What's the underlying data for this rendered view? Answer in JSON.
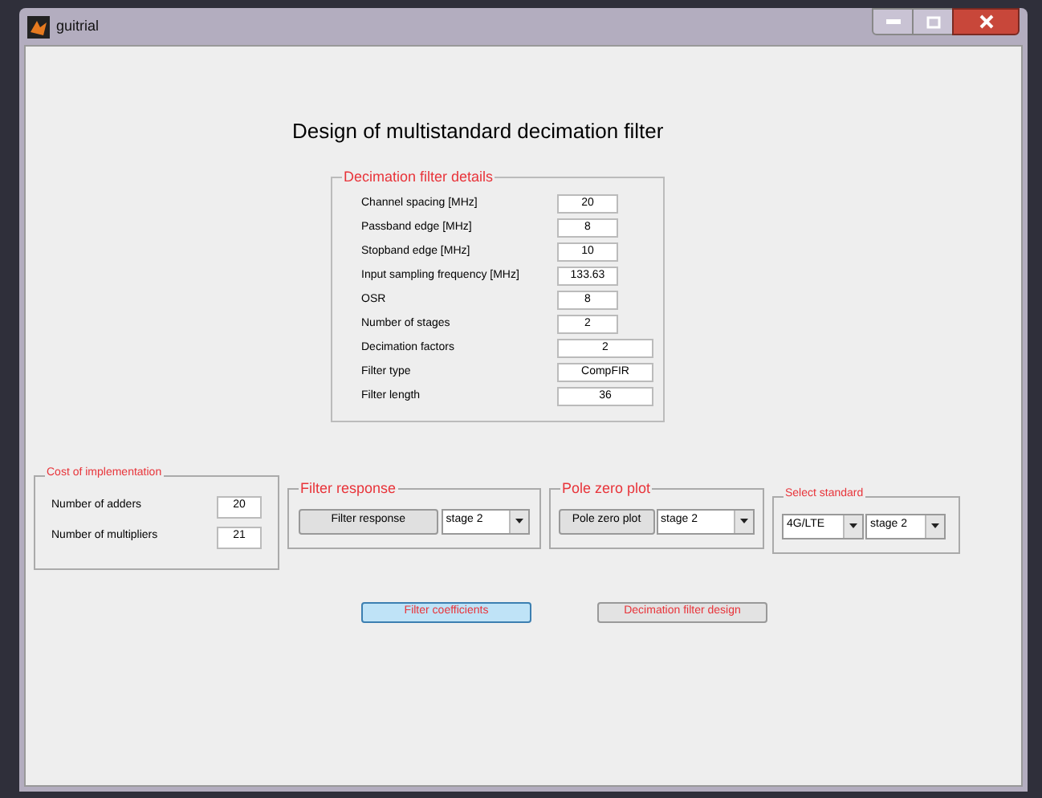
{
  "window": {
    "title": "guitrial"
  },
  "heading": "Design of multistandard decimation filter",
  "details": {
    "title": "Decimation filter details",
    "rows": [
      {
        "label": "Channel spacing [MHz]",
        "value": "20",
        "kind": "narrow"
      },
      {
        "label": "Passband edge [MHz]",
        "value": "8",
        "kind": "narrow"
      },
      {
        "label": "Stopband edge [MHz]",
        "value": "10",
        "kind": "narrow"
      },
      {
        "label": "Input sampling frequency [MHz]",
        "value": "133.63",
        "kind": "narrow"
      },
      {
        "label": "OSR",
        "value": "8",
        "kind": "narrow"
      },
      {
        "label": "Number of stages",
        "value": "2",
        "kind": "narrow"
      },
      {
        "label": "Decimation factors",
        "value": "2",
        "kind": "wide"
      },
      {
        "label": "Filter type",
        "value": "CompFIR",
        "kind": "wide"
      },
      {
        "label": "Filter length",
        "value": "36",
        "kind": "wide"
      }
    ]
  },
  "cost": {
    "title": "Cost of implementation",
    "rows": [
      {
        "label": "Number of adders",
        "value": "20"
      },
      {
        "label": "Number of multipliers",
        "value": "21"
      }
    ]
  },
  "filter_response": {
    "title": "Filter response",
    "button": "Filter response",
    "dropdown": "stage 2"
  },
  "pole_zero": {
    "title": "Pole zero plot",
    "button": "Pole zero plot",
    "dropdown": "stage 2"
  },
  "select_standard": {
    "title": "Select standard",
    "dropdowns": [
      "4G/LTE",
      "stage 2"
    ]
  },
  "buttons": [
    {
      "label": "Filter coefficients",
      "focused": true
    },
    {
      "label": "Decimation filter design",
      "focused": false
    }
  ]
}
